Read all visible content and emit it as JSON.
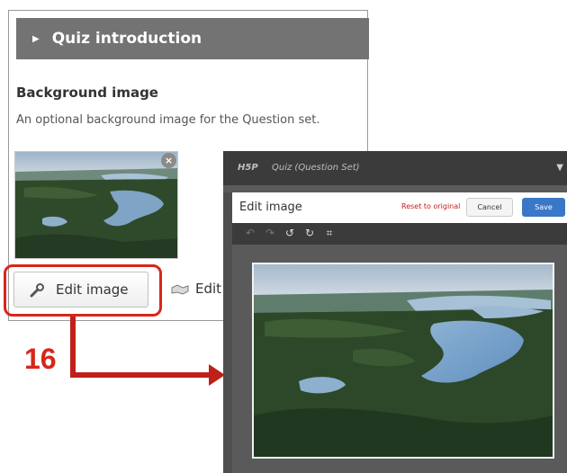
{
  "editor": {
    "section_title": "Quiz introduction",
    "field_label": "Background image",
    "field_description": "An optional background image for the Question set.",
    "remove_symbol": "×",
    "edit_image_label": "Edit image",
    "edit_copyright_label": "Edit"
  },
  "annotation": {
    "step_number": "16",
    "color": "#d7261b"
  },
  "dialog": {
    "app_logo": "H5P",
    "content_title": "Quiz (Question Set)",
    "header_title": "Edit image",
    "reset_label": "Reset to original",
    "cancel_label": "Cancel",
    "save_label": "Save",
    "save_color": "#3a78c7",
    "toolbar": {
      "undo_symbol": "↶",
      "redo_symbol": "↷",
      "rotate_left_symbol": "↺",
      "rotate_right_symbol": "↻",
      "crop_symbol": "⌗"
    }
  }
}
